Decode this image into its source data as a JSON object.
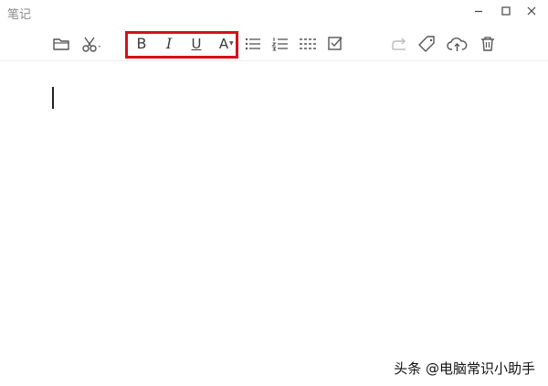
{
  "app": {
    "title": "笔记"
  },
  "window_controls": {
    "minimize": "minimize-icon",
    "maximize": "maximize-icon",
    "close": "close-icon"
  },
  "toolbar": {
    "folder": "folder-icon",
    "cut": "scissors-icon",
    "bold_label": "B",
    "italic_label": "I",
    "underline_label": "U",
    "font_color_label": "A",
    "bullet_list": "bullet-list-icon",
    "numbered_list": "numbered-list-icon",
    "divider_line": "dashed-lines-icon",
    "checkbox": "checkbox-icon",
    "share": "share-icon",
    "tag": "tag-icon",
    "upload": "cloud-upload-icon",
    "delete": "trash-icon"
  },
  "highlight": {
    "color": "#d4111b"
  },
  "watermark": {
    "text": "头条 @电脑常识小助手"
  }
}
